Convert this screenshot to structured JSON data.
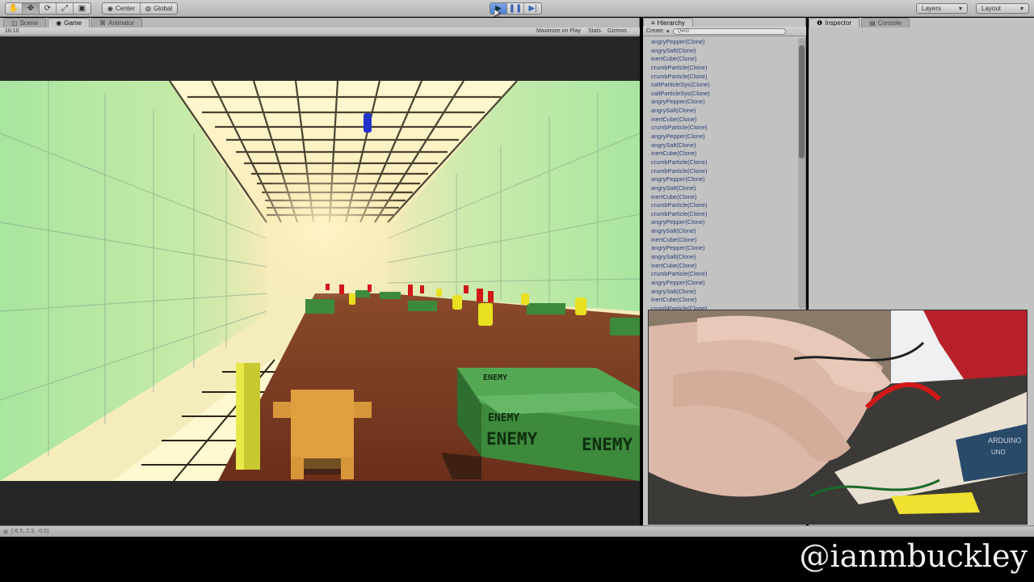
{
  "toolbar": {
    "pivot_label": "Center",
    "space_label": "Global",
    "layers_label": "Layers",
    "layout_label": "Layout"
  },
  "scene_tabs": [
    "Scene",
    "Game",
    "Animator"
  ],
  "game_bar": {
    "aspect": "16:10",
    "maximize_label": "Maximize on Play",
    "stats_label": "Stats",
    "gizmos_label": "Gizmos"
  },
  "hierarchy": {
    "tab_label": "Hierarchy",
    "create_label": "Create",
    "search_placeholder": "Q▾All",
    "items": [
      "angryPepper(Clone)",
      "angrySalt(Clone)",
      "inertCube(Clone)",
      "crumbParticle(Clone)",
      "crumbParticle(Clone)",
      "saltParticleSys(Clone)",
      "saltParticleSys(Clone)",
      "angryPepper(Clone)",
      "angrySalt(Clone)",
      "inertCube(Clone)",
      "crumbParticle(Clone)",
      "angryPepper(Clone)",
      "angrySalt(Clone)",
      "inertCube(Clone)",
      "crumbParticle(Clone)",
      "crumbParticle(Clone)",
      "angryPepper(Clone)",
      "angrySalt(Clone)",
      "inertCube(Clone)",
      "crumbParticle(Clone)",
      "crumbParticle(Clone)",
      "angryPepper(Clone)",
      "angrySalt(Clone)",
      "inertCube(Clone)",
      "angryPepper(Clone)",
      "angrySalt(Clone)",
      "inertCube(Clone)",
      "crumbParticle(Clone)",
      "angryPepper(Clone)",
      "angrySalt(Clone)",
      "inertCube(Clone)",
      "crumbParticle(Clone)"
    ]
  },
  "inspector": {
    "tab_label": "Inspector",
    "console_label": "Console"
  },
  "game_view": {
    "crate_label": "ENEMY"
  },
  "webcam": {
    "board_label": "ARDUINO",
    "board_sublabel": "UNO"
  },
  "status_bar": {
    "text": "(-6.5, 2.3, -0.5)"
  },
  "overlay": {
    "handle": "@ianmbuckley"
  },
  "colors": {
    "wall_green": "#a8e8a8",
    "ceiling_light": "#fff6c8",
    "floor_wood": "#7a3a22",
    "enemy_crate": "#3d8a3d",
    "player": "#e0a040",
    "play_button": "#4a7ed0"
  }
}
